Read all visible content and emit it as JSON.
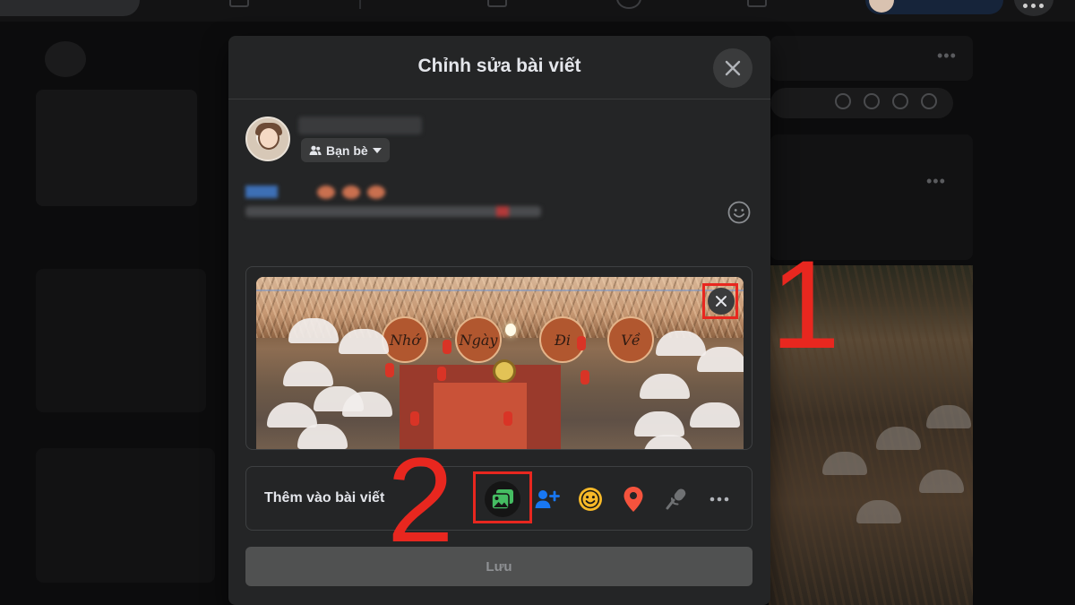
{
  "modal": {
    "title": "Chỉnh sửa bài viết",
    "close_icon": "close-icon"
  },
  "author": {
    "audience_label": "Bạn bè",
    "audience_icon": "friends-icon"
  },
  "post": {
    "emoji_icon": "emoji-icon"
  },
  "attachment": {
    "remove_icon": "close-icon"
  },
  "add_to_post": {
    "label": "Thêm vào bài viết",
    "tools": [
      {
        "name": "photo-video-icon",
        "color": "#45bd62"
      },
      {
        "name": "tag-people-icon",
        "color": "#1877f2"
      },
      {
        "name": "feeling-icon",
        "color": "#f7b928"
      },
      {
        "name": "location-icon",
        "color": "#f5533d"
      },
      {
        "name": "mic-icon",
        "color": "#6f7173"
      },
      {
        "name": "more-icon",
        "color": "#b0b3b8"
      }
    ]
  },
  "save_label": "Lưu",
  "annotations": {
    "step_1": "1",
    "step_2": "2",
    "color": "#e8271f"
  },
  "photo_signs": [
    "Nhớ",
    "Ngày",
    "Đi",
    "Về"
  ]
}
